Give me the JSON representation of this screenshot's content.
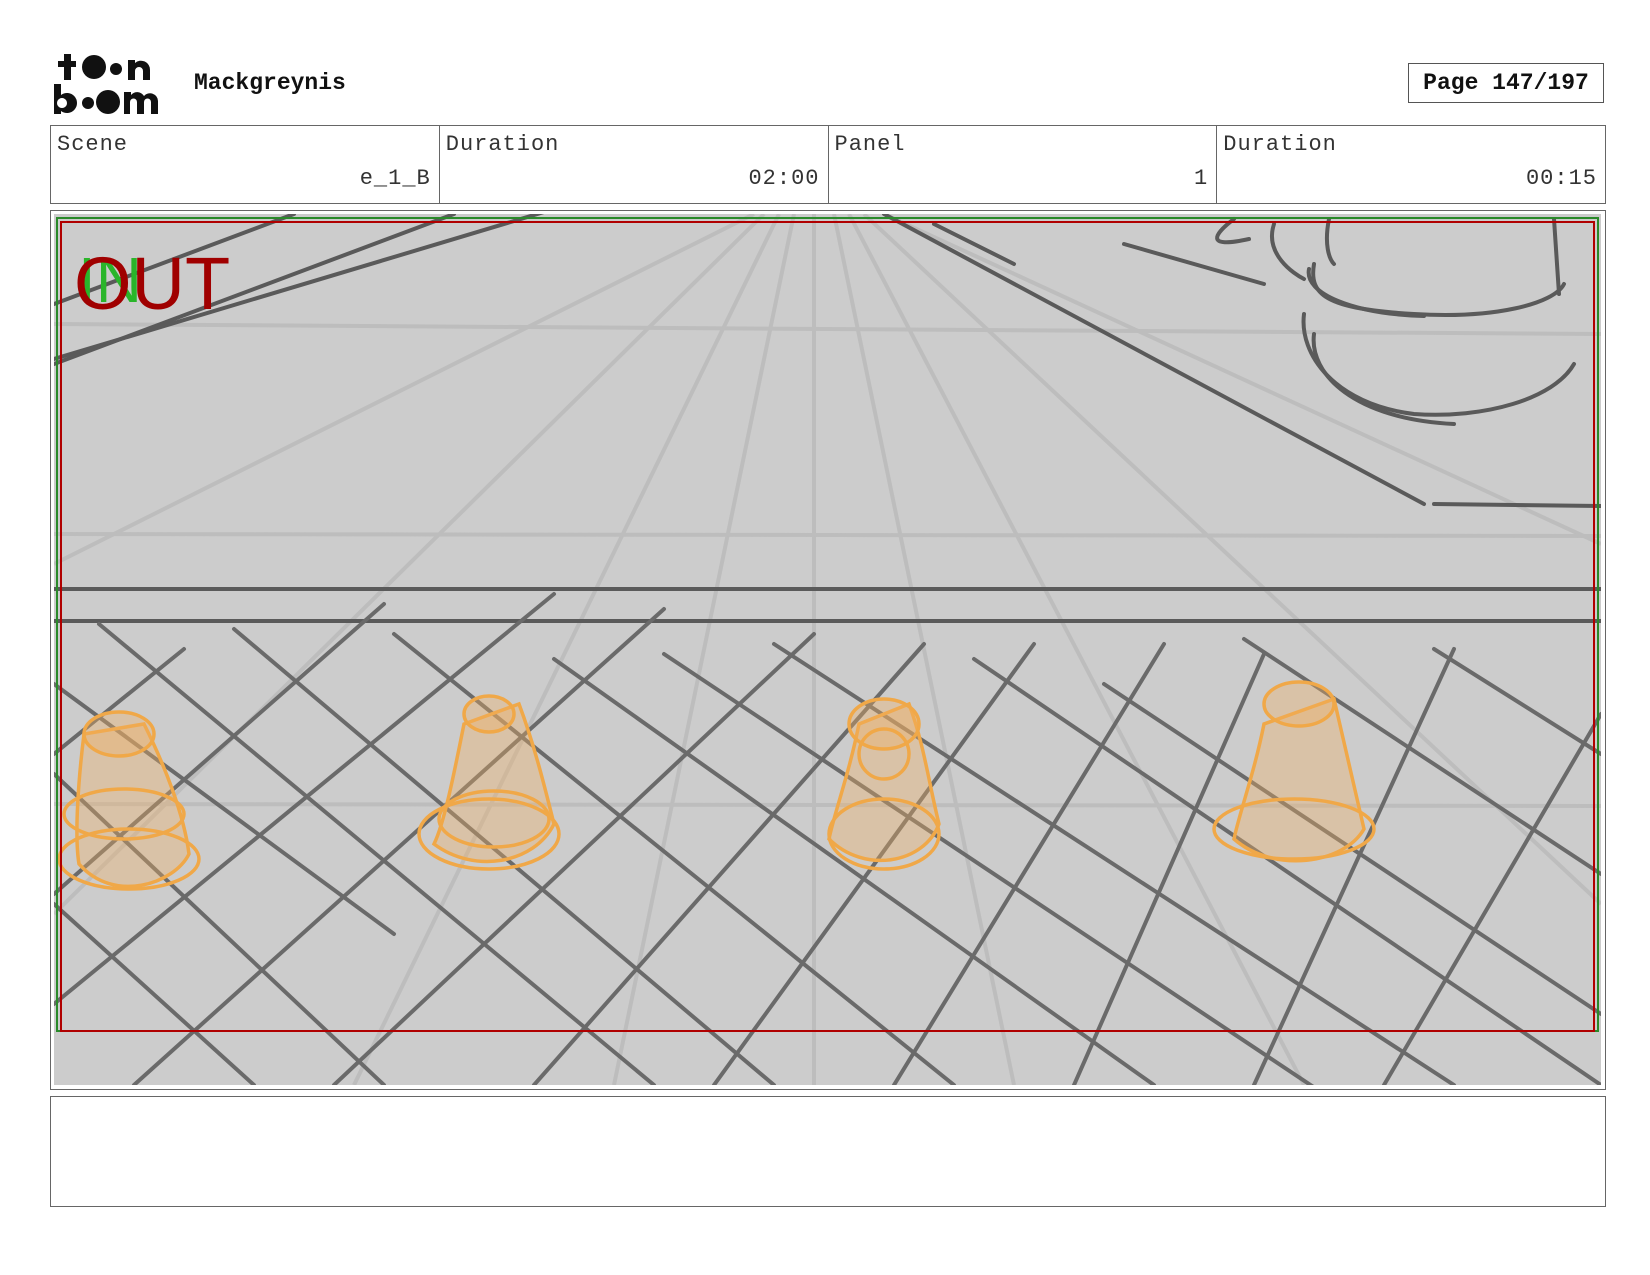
{
  "header": {
    "logo_name": "toonboom-logo",
    "project_title": "Mackgreynis",
    "page_label": "Page 147/197"
  },
  "info": {
    "scene_label": "Scene",
    "scene_value": "e_1_B",
    "scene_duration_label": "Duration",
    "scene_duration_value": "02:00",
    "panel_label": "Panel",
    "panel_value": "1",
    "panel_duration_label": "Duration",
    "panel_duration_value": "00:15"
  },
  "panel": {
    "in_marker": "IN",
    "out_marker": "OUT",
    "colors": {
      "background": "#cccccc",
      "safe_frame": "#b00000",
      "action_frame": "#2a8a2a",
      "sketch": "#5a5a5a",
      "cones": "#f0b060"
    }
  },
  "notes": {
    "text": ""
  }
}
